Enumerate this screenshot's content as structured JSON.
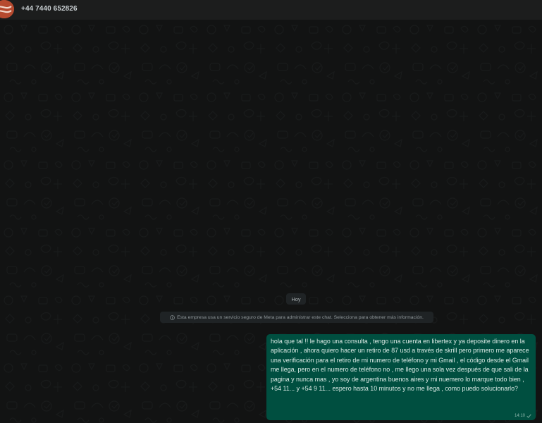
{
  "header": {
    "contact_name": "+44 7440 652826",
    "avatar_icon": "brand-logo-icon"
  },
  "chat": {
    "date_separator": "Hoy",
    "system_notice": "Esta empresa usa un servicio seguro de Meta para administrar este chat. Selecciona para obtener más información.",
    "system_notice_icon": "info-icon",
    "messages": [
      {
        "direction": "outgoing",
        "text": "hola que tal !! le hago una consulta , tengo una cuenta en libertex y ya deposite dinero en la aplicación , ahora quiero hacer un retiro de 87 usd a través de skrill pero primero me aparece una verificación para el retiro de mi numero de teléfono y mi Gmail , el código desde el Gmail me llega, pero en el numero de teléfono no , me llego una sola vez después de que sali de la pagina y nunca mas , yo soy de argentina buenos aires y mi nuemero lo marque todo bien , +54 11... y +54 9 11... espero hasta 10 minutos y no me llega , como puedo solucionarlo?",
        "time": "14:10",
        "status_icon": "single-check-icon"
      }
    ]
  },
  "colors": {
    "chat_background": "#121313",
    "header_background": "#1c1d1d",
    "outgoing_bubble": "#004f40",
    "avatar": "#b64a2f"
  }
}
